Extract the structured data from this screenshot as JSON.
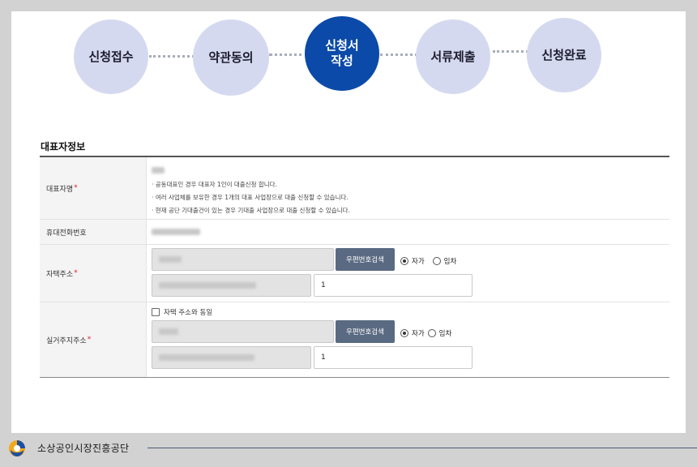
{
  "steps": [
    {
      "label": "신청접수",
      "active": false
    },
    {
      "label": "약관동의",
      "active": false
    },
    {
      "label": "신청서\n작성",
      "active": true
    },
    {
      "label": "서류제출",
      "active": false
    },
    {
      "label": "신청완료",
      "active": false
    }
  ],
  "section_title": "대표자정보",
  "rows": {
    "name": {
      "label": "대표자명",
      "required": "*",
      "notes": [
        "· 공동대표인 경우 대표자 1인이 대출신청 합니다.",
        "· 여러 사업체를 보유한 경우 1개의 대표 사업장으로 대출 신청할 수 있습니다.",
        "· 현재 공단 기대출건이 있는 경우 기대출 사업장으로 대출 신청할 수 있습니다."
      ]
    },
    "phone": {
      "label": "휴대전화번호"
    },
    "home_address": {
      "label": "자택주소",
      "required": "*",
      "search_button": "우편번호검색",
      "radio_own": "자가",
      "radio_rent": "임차",
      "detail_value": "1"
    },
    "residence_address": {
      "label": "실거주지주소",
      "required": "*",
      "same_checkbox": "자택 주소와 동일",
      "search_button": "우편번호검색",
      "radio_own": "자가",
      "radio_rent": "임차",
      "detail_value": "1"
    }
  },
  "footer": {
    "brand": "소상공인시장진흥공단"
  },
  "colors": {
    "step_inactive": "#d5d9f0",
    "step_active": "#0b4aa8",
    "button": "#5a6a82",
    "required": "#e02020"
  }
}
